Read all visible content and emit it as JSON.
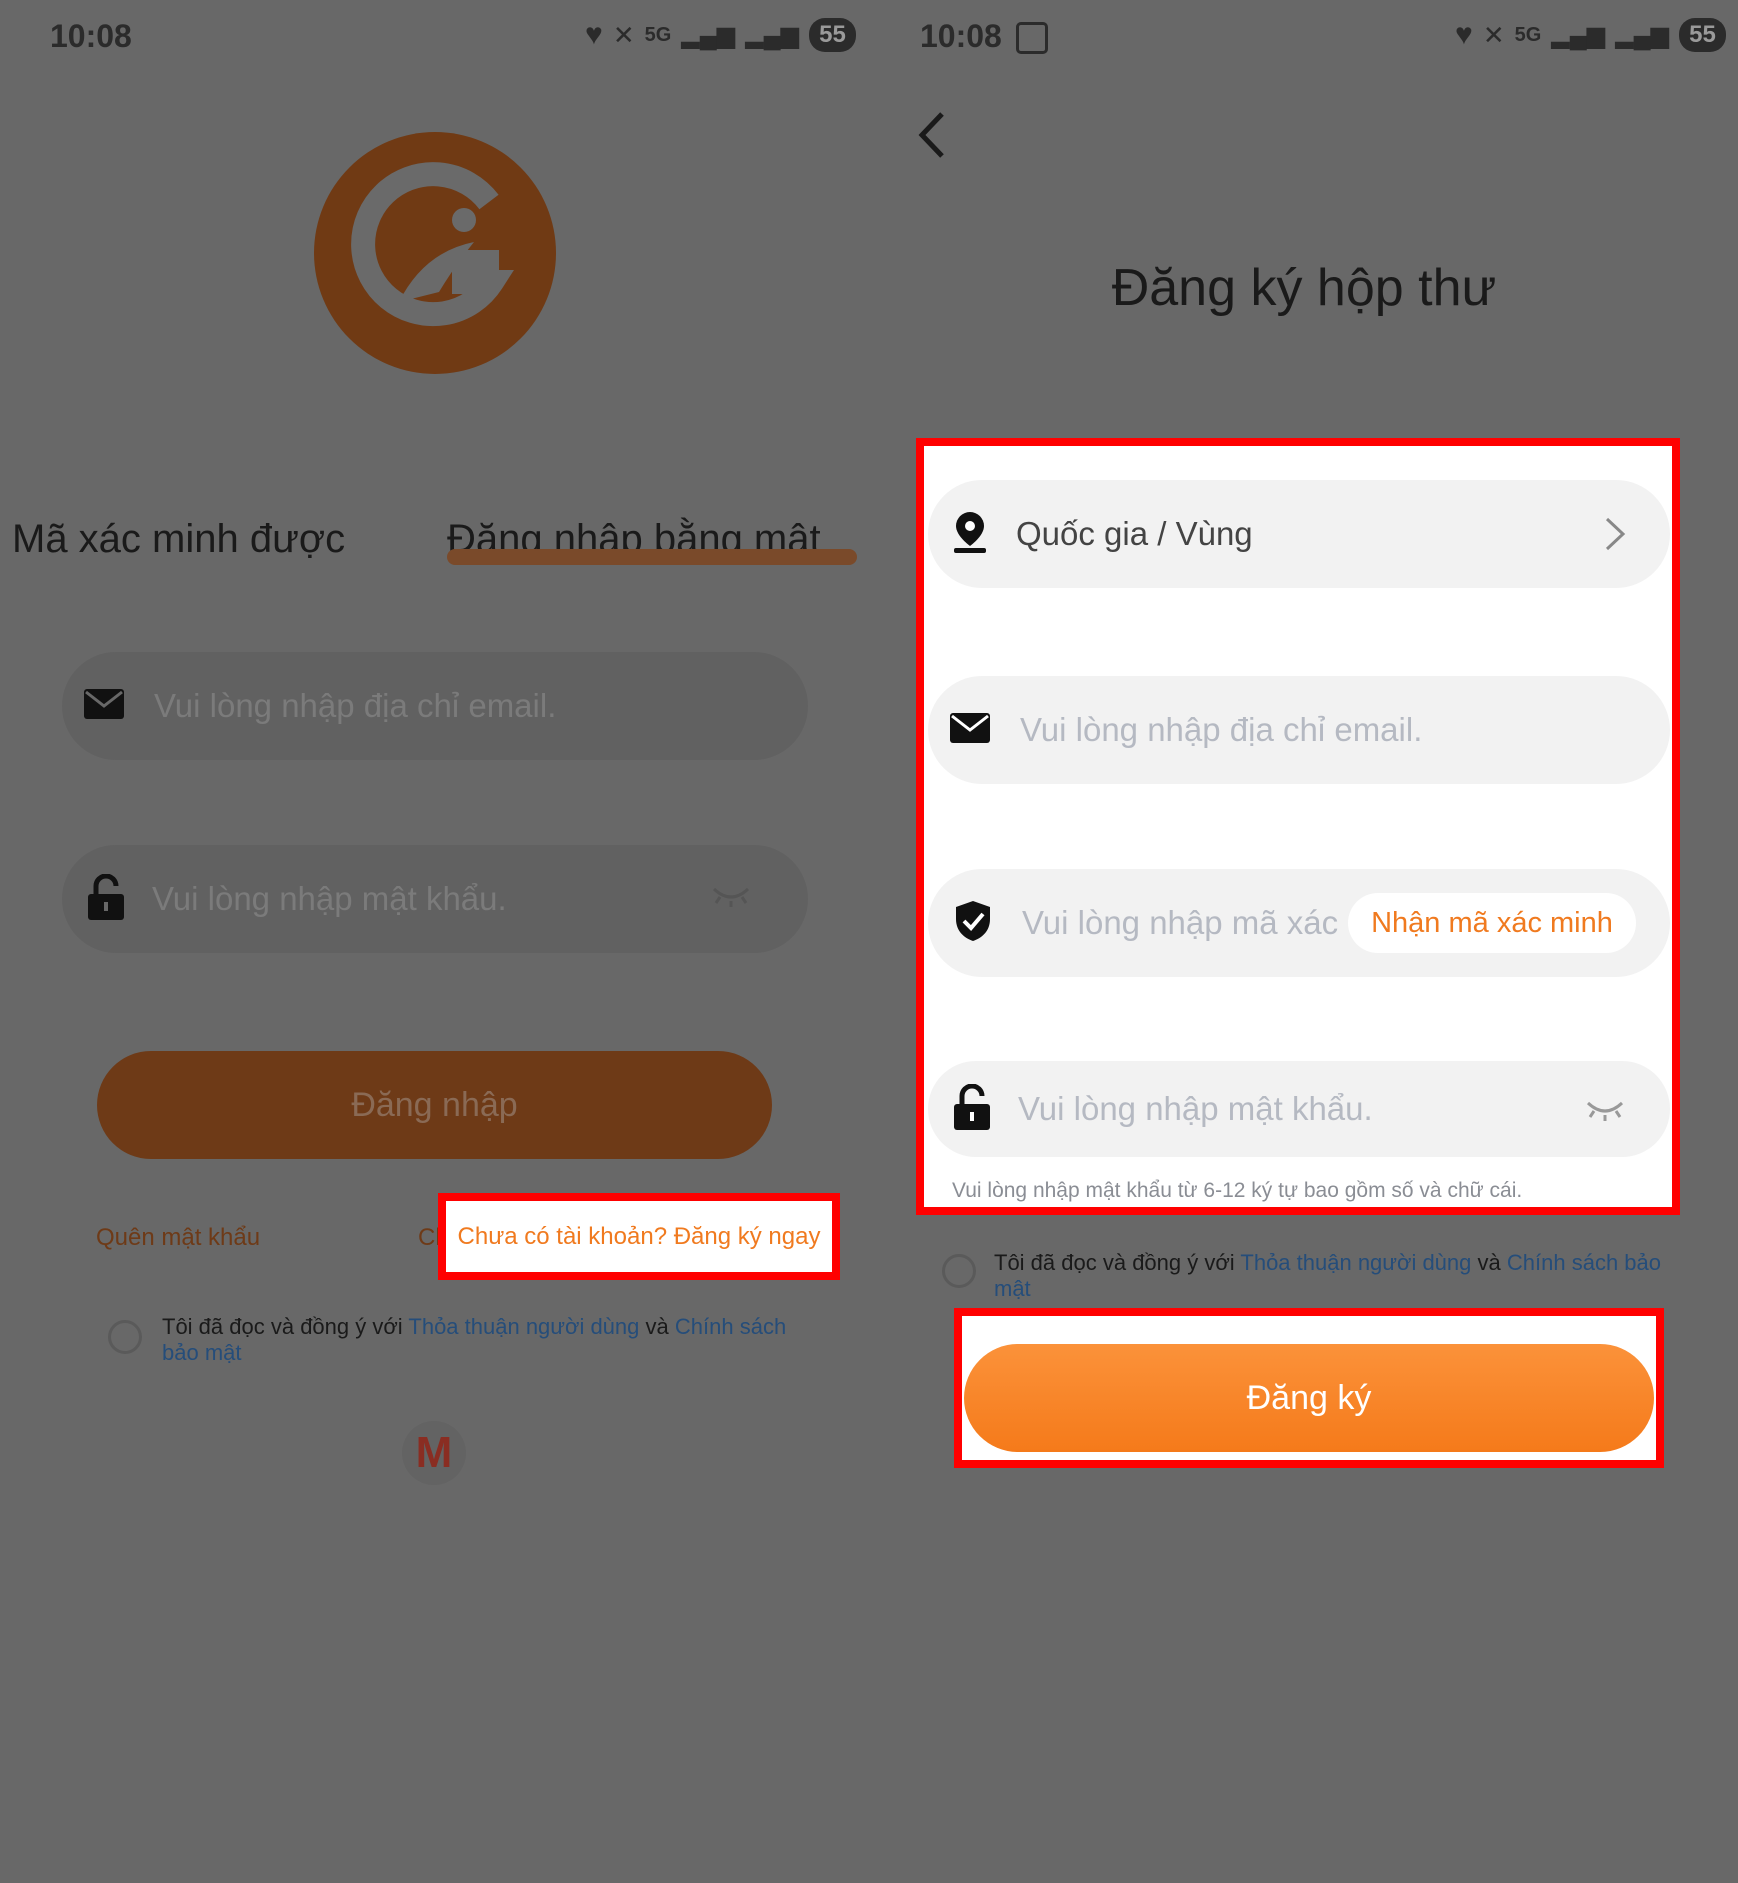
{
  "status_bar": {
    "time": "10:08",
    "battery": "55",
    "net": "5G"
  },
  "login": {
    "tabs": [
      "Mã xác minh được",
      "Đăng nhập bằng mật"
    ],
    "email_placeholder": "Vui lòng nhập địa chỉ email.",
    "password_placeholder": "Vui lòng nhập mật khẩu.",
    "login_button": "Đăng nhập",
    "forgot_password": "Quên mật khẩu",
    "register_prefix": "Cl",
    "register_link": "Chưa có tài khoản? Đăng ký ngay",
    "agree_prefix": "Tôi đã đọc và đồng ý với",
    "user_agreement": "Thỏa thuận người dùng",
    "and": "và",
    "privacy_line1": "Chính sách",
    "privacy_line2": "bảo mật",
    "gmail_letter": "M"
  },
  "register": {
    "title": "Đăng ký hộp thư",
    "country_placeholder": "Quốc gia / Vùng",
    "email_placeholder": "Vui lòng nhập địa chỉ email.",
    "code_placeholder": "Vui lòng nhập mã xác",
    "get_code_button": "Nhận mã xác minh",
    "password_placeholder": "Vui lòng nhập mật khẩu.",
    "password_hint": "Vui lòng nhập mật khẩu từ 6-12 ký tự bao gồm số và chữ cái.",
    "agree_prefix": "Tôi đã đọc và đồng ý với",
    "user_agreement": "Thỏa thuận người dùng",
    "and": "và",
    "privacy_line1": "Chính sách bảo",
    "privacy_line2": "mật",
    "register_button": "Đăng ký"
  },
  "colors": {
    "accent": "#f07a1f",
    "highlight": "#ff0000",
    "overlay": "#686868",
    "link": "#2f73c9"
  }
}
